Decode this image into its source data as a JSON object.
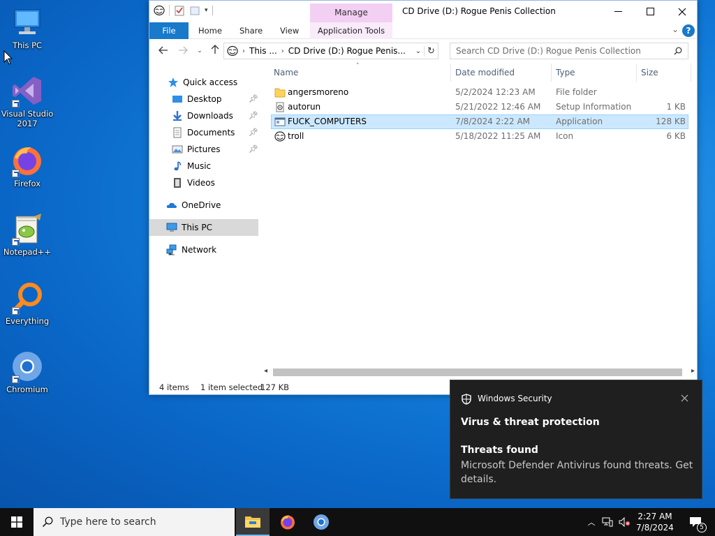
{
  "desktop": {
    "icons": [
      {
        "label": "This PC"
      },
      {
        "label": "Visual Studio 2017"
      },
      {
        "label": "Firefox"
      },
      {
        "label": "Notepad++"
      },
      {
        "label": "Everything"
      },
      {
        "label": "Chromium"
      }
    ]
  },
  "explorer": {
    "title": "CD Drive (D:) Rogue Penis Collection",
    "manage_tab": "Manage",
    "ribbon_tabs": [
      "File",
      "Home",
      "Share",
      "View",
      "Application Tools"
    ],
    "help": "?",
    "address": {
      "seg1": "This ...",
      "seg2": "CD Drive (D:) Rogue Penis..."
    },
    "search_placeholder": "Search CD Drive (D:) Rogue Penis Collection",
    "nav": {
      "quick_access": "Quick access",
      "desktop": "Desktop",
      "downloads": "Downloads",
      "documents": "Documents",
      "pictures": "Pictures",
      "music": "Music",
      "videos": "Videos",
      "onedrive": "OneDrive",
      "this_pc": "This PC",
      "network": "Network"
    },
    "columns": {
      "name": "Name",
      "date": "Date modified",
      "type": "Type",
      "size": "Size"
    },
    "files": [
      {
        "name": "angersmoreno",
        "date": "5/2/2024 12:23 AM",
        "type": "File folder",
        "size": ""
      },
      {
        "name": "autorun",
        "date": "5/21/2022 12:46 AM",
        "type": "Setup Information",
        "size": "1 KB"
      },
      {
        "name": "FUCK_COMPUTERS",
        "date": "7/8/2024 2:22 AM",
        "type": "Application",
        "size": "128 KB"
      },
      {
        "name": "troll",
        "date": "5/18/2022 11:25 AM",
        "type": "Icon",
        "size": "6 KB"
      }
    ],
    "status": {
      "items": "4 items",
      "selected": "1 item selected",
      "size": "127 KB"
    }
  },
  "toast": {
    "app": "Windows Security",
    "heading": "Virus & threat protection",
    "title": "Threats found",
    "body": "Microsoft Defender Antivirus found threats. Get details."
  },
  "taskbar": {
    "search_placeholder": "Type here to search",
    "time": "2:27 AM",
    "date": "7/8/2024",
    "notifications": "5"
  },
  "colors": {
    "accent": "#1979ca",
    "selection": "#cce8ff",
    "manage": "#f3cff3",
    "toast_bg": "#1f1f1f",
    "taskbar_bg": "#101010"
  }
}
